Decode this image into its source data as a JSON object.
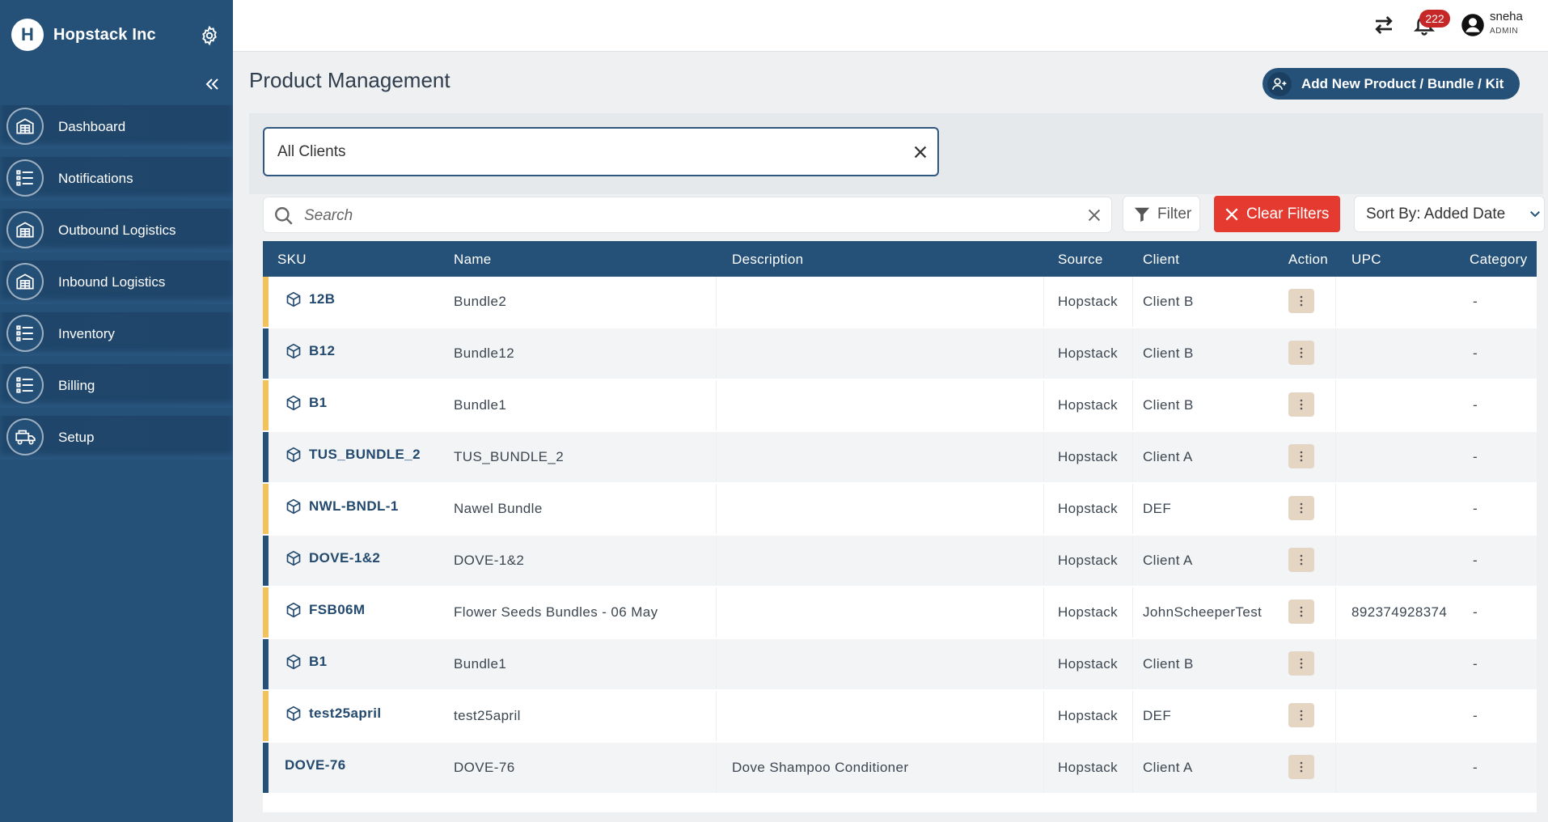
{
  "brand": {
    "name": "Hopstack Inc",
    "logo_letter": "H"
  },
  "sidebar": {
    "items": [
      {
        "label": "Dashboard",
        "icon": "warehouse-icon"
      },
      {
        "label": "Notifications",
        "icon": "list-icon"
      },
      {
        "label": "Outbound Logistics",
        "icon": "warehouse-icon"
      },
      {
        "label": "Inbound Logistics",
        "icon": "warehouse-icon"
      },
      {
        "label": "Inventory",
        "icon": "list-icon"
      },
      {
        "label": "Billing",
        "icon": "list-icon"
      },
      {
        "label": "Setup",
        "icon": "truck-icon"
      }
    ]
  },
  "topbar": {
    "notification_count": "222",
    "user_name": "sneha",
    "user_role": "ADMIN"
  },
  "page": {
    "title": "Product Management",
    "add_button_label": "Add New Product / Bundle / Kit"
  },
  "filters": {
    "client_select_value": "All Clients",
    "search_placeholder": "Search",
    "filter_label": "Filter",
    "clear_filters_label": "Clear Filters",
    "sort_label": "Sort By: Added Date"
  },
  "table": {
    "columns": [
      "SKU",
      "Name",
      "Description",
      "Source",
      "Client",
      "Action",
      "UPC",
      "Category"
    ],
    "rows": [
      {
        "sku": "12B",
        "name": "Bundle2",
        "description": "",
        "source": "Hopstack",
        "client": "Client B",
        "upc": "",
        "category": "-",
        "bundle": true,
        "stripe": "#f3c259"
      },
      {
        "sku": "B12",
        "name": "Bundle12",
        "description": "",
        "source": "Hopstack",
        "client": "Client B",
        "upc": "",
        "category": "-",
        "bundle": true,
        "stripe": "#255178"
      },
      {
        "sku": "B1",
        "name": "Bundle1",
        "description": "",
        "source": "Hopstack",
        "client": "Client B",
        "upc": "",
        "category": "-",
        "bundle": true,
        "stripe": "#f3c259"
      },
      {
        "sku": "TUS_BUNDLE_2",
        "name": "TUS_BUNDLE_2",
        "description": "",
        "source": "Hopstack",
        "client": "Client A",
        "upc": "",
        "category": "-",
        "bundle": true,
        "stripe": "#255178"
      },
      {
        "sku": "NWL-BNDL-1",
        "name": "Nawel Bundle",
        "description": "",
        "source": "Hopstack",
        "client": "DEF",
        "upc": "",
        "category": "-",
        "bundle": true,
        "stripe": "#f3c259"
      },
      {
        "sku": "DOVE-1&2",
        "name": "DOVE-1&2",
        "description": "",
        "source": "Hopstack",
        "client": "Client A",
        "upc": "",
        "category": "-",
        "bundle": true,
        "stripe": "#255178"
      },
      {
        "sku": "FSB06M",
        "name": "Flower Seeds Bundles - 06 May",
        "description": "",
        "source": "Hopstack",
        "client": "JohnScheeperTest",
        "upc": "892374928374",
        "category": "-",
        "bundle": true,
        "stripe": "#f3c259"
      },
      {
        "sku": "B1",
        "name": "Bundle1",
        "description": "",
        "source": "Hopstack",
        "client": "Client B",
        "upc": "",
        "category": "-",
        "bundle": true,
        "stripe": "#255178"
      },
      {
        "sku": "test25april",
        "name": "test25april",
        "description": "",
        "source": "Hopstack",
        "client": "DEF",
        "upc": "",
        "category": "-",
        "bundle": true,
        "stripe": "#f3c259"
      },
      {
        "sku": "DOVE-76",
        "name": "DOVE-76",
        "description": "Dove Shampoo Conditioner",
        "source": "Hopstack",
        "client": "Client A",
        "upc": "",
        "category": "-",
        "bundle": false,
        "stripe": "#255178"
      }
    ]
  },
  "colors": {
    "sidebar_bg": "#255178",
    "primary": "#255178",
    "danger": "#e43a2f",
    "stripe_gold": "#f3c259",
    "action_btn": "#e4d6c3"
  }
}
